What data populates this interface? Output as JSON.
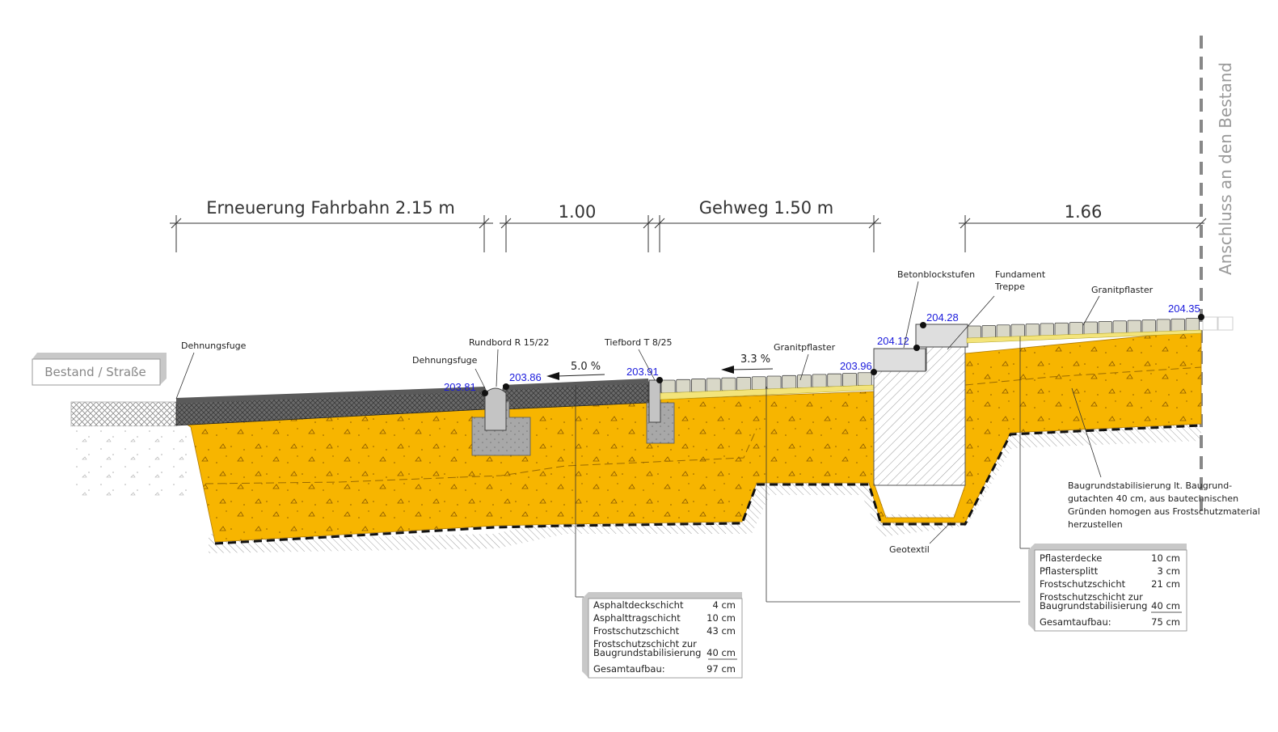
{
  "dimensions": {
    "fahrbahn": "Erneuerung Fahrbahn 2.15 m",
    "mid": "1.00",
    "gehweg": "Gehweg 1.50 m",
    "right": "1.66"
  },
  "side_labels": {
    "anschluss": "Anschluss an den Bestand",
    "bestand": "Bestand / Straße"
  },
  "labels": {
    "dehnungsfuge_left": "Dehnungsfuge",
    "dehnungsfuge_mid": "Dehnungsfuge",
    "rundbord": "Rundbord R 15/22",
    "tiefbord": "Tiefbord T 8/25",
    "granitpflaster_mid": "Granitpflaster",
    "granitpflaster_right": "Granitpflaster",
    "betonblockstufen": "Betonblockstufen",
    "fundament_1": "Fundament",
    "fundament_2": "Treppe",
    "geotextil": "Geotextil",
    "baugrund_1": "Baugrundstabilisierung lt. Baugrund-",
    "baugrund_2": "gutachten 40 cm, aus bautechnischen",
    "baugrund_3": "Gründen homogen aus Frostschutzmaterial",
    "baugrund_4": "herzustellen"
  },
  "elevations": {
    "e1": "203.81",
    "e2": "203.86",
    "e3": "203.91",
    "e4": "203.96",
    "e5": "204.12",
    "e6": "204.28",
    "e7": "204.35"
  },
  "slopes": {
    "s1": "5.0 %",
    "s2": "3.3 %"
  },
  "table_road": {
    "rows": [
      {
        "name": "Asphaltdeckschicht",
        "value": "4 cm"
      },
      {
        "name": "Asphalttragschicht",
        "value": "10 cm"
      },
      {
        "name": "Frostschutzschicht",
        "value": "43 cm"
      }
    ],
    "stab_1": "Frostschutzschicht zur",
    "stab_2": "Baugrundstabilisierung",
    "stab_value": "40 cm",
    "total_name": "Gesamtaufbau:",
    "total_value": "97 cm"
  },
  "table_walk": {
    "rows": [
      {
        "name": "Pflasterdecke",
        "value": "10 cm"
      },
      {
        "name": "Pflastersplitt",
        "value": "3 cm"
      },
      {
        "name": "Frostschutzschicht",
        "value": "21 cm"
      }
    ],
    "stab_1": "Frostschutzschicht zur",
    "stab_2": "Baugrundstabilisierung",
    "stab_value": "40 cm",
    "total_name": "Gesamtaufbau:",
    "total_value": "75 cm"
  },
  "colors": {
    "frostschutz": "#f7b500",
    "asphalt": "#555555",
    "elevation_text": "#1a1adc",
    "pavers": "#d9d8c8"
  }
}
